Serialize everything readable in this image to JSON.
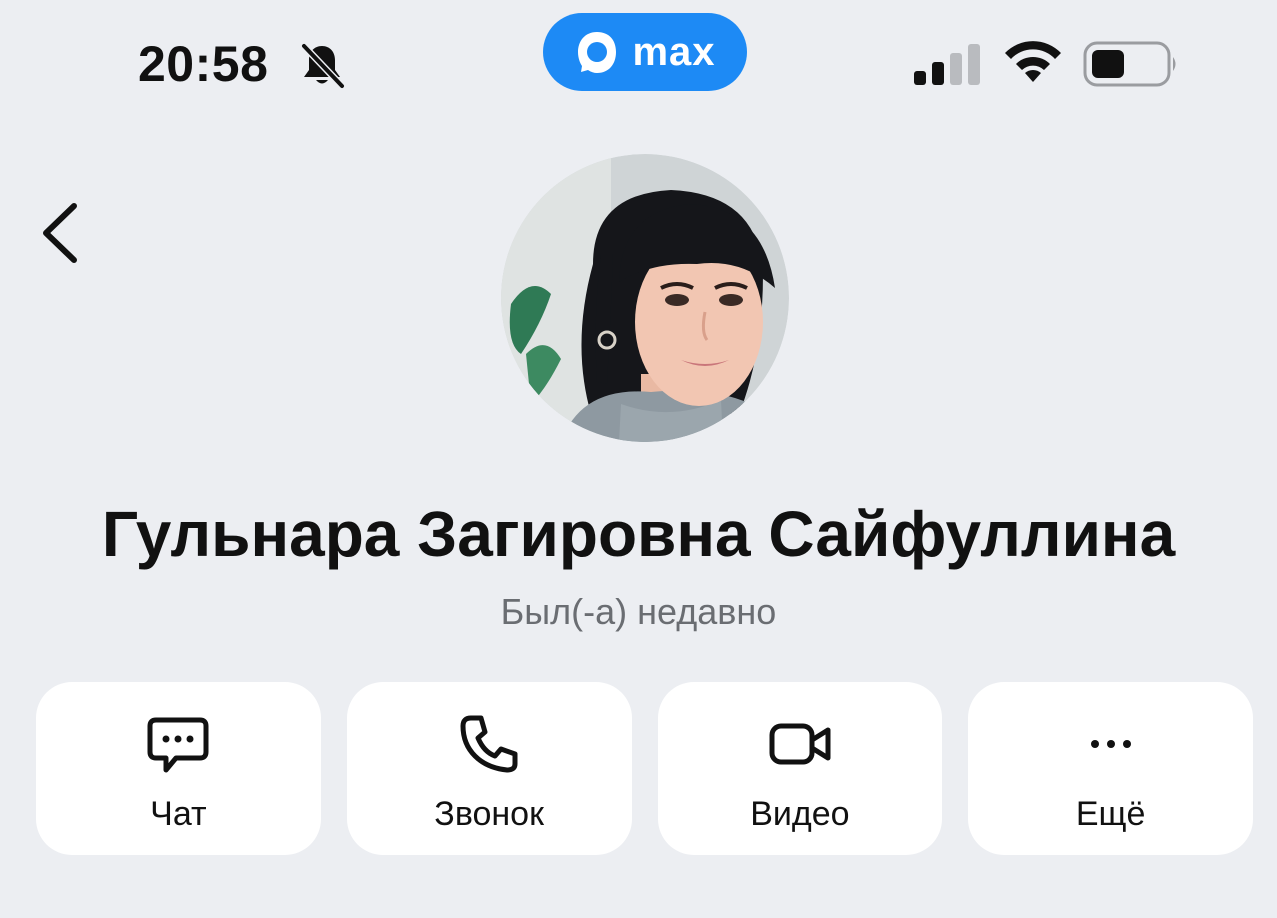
{
  "status_bar": {
    "time": "20:58",
    "bell_icon": "bell-slash-icon",
    "signal_icon": "cellular-signal-icon",
    "wifi_icon": "wifi-icon",
    "battery_icon": "battery-icon"
  },
  "app_badge": {
    "name": "max",
    "color": "#1d8af5"
  },
  "nav": {
    "back_icon": "chevron-left-icon"
  },
  "profile": {
    "name": "Гульнара Загировна Сайфуллина",
    "status": "Был(-а) недавно"
  },
  "actions": [
    {
      "label": "Чат",
      "icon": "chat-bubble-icon"
    },
    {
      "label": "Звонок",
      "icon": "phone-icon"
    },
    {
      "label": "Видео",
      "icon": "video-camera-icon"
    },
    {
      "label": "Ещё",
      "icon": "more-dots-icon"
    }
  ],
  "colors": {
    "background": "#eceef2",
    "card": "#ffffff",
    "accent": "#1d8af5",
    "secondary_text": "#6a6d72"
  }
}
